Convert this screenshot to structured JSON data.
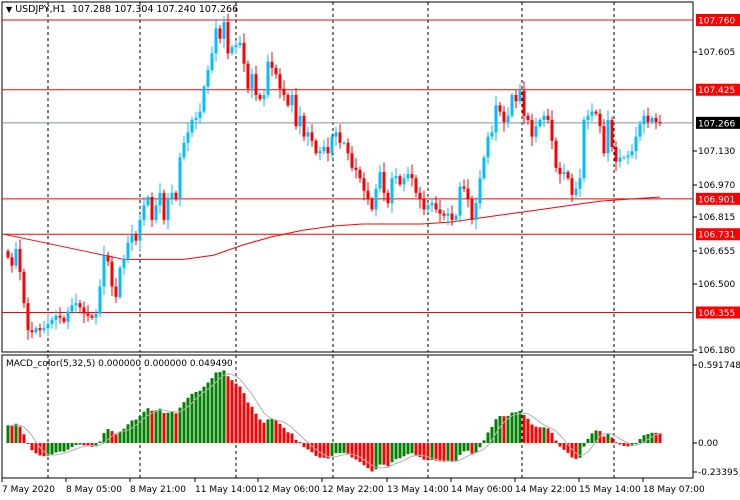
{
  "header": {
    "symbol": "USDJPY,H1",
    "open": "107.288",
    "high": "107.304",
    "low": "107.240",
    "close": "107.266"
  },
  "macd_header": {
    "label": "MACD_color(5,32,5)",
    "v1": "0.000000",
    "v2": "0.000000",
    "v3": "0.049490"
  },
  "colors": {
    "bull": "#00bfff",
    "bear": "#ff0000",
    "macd_up": "#008000",
    "macd_down": "#ff0000",
    "level": "#ff0000",
    "current": "#8090a0",
    "signal": "#b0b0b0"
  },
  "chart_data": [
    {
      "type": "candlestick",
      "title": "USDJPY,H1",
      "ylim": [
        106.18,
        107.76
      ],
      "y_ticks": [
        "107.605",
        "107.130",
        "106.970",
        "106.815",
        "106.655",
        "106.500",
        "106.180"
      ],
      "levels": [
        {
          "value": 107.76,
          "label": "107.760"
        },
        {
          "value": 107.425,
          "label": "107.425"
        },
        {
          "value": 106.901,
          "label": "106.901"
        },
        {
          "value": 106.731,
          "label": "106.731"
        },
        {
          "value": 106.355,
          "label": "106.355"
        }
      ],
      "current_price": {
        "value": 107.266,
        "label": "107.266"
      },
      "x_labels": [
        "7 May 2020",
        "8 May 05:00",
        "8 May 21:00",
        "11 May 14:00",
        "12 May 06:00",
        "12 May 22:00",
        "13 May 14:00",
        "14 May 06:00",
        "14 May 22:00",
        "15 May 14:00",
        "18 May 07:00"
      ],
      "closes": [
        106.62,
        106.58,
        106.66,
        106.55,
        106.4,
        106.27,
        106.26,
        106.28,
        106.27,
        106.28,
        106.3,
        106.32,
        106.34,
        106.33,
        106.31,
        106.36,
        106.39,
        106.4,
        106.38,
        106.35,
        106.34,
        106.33,
        106.35,
        106.48,
        106.63,
        106.6,
        106.48,
        106.43,
        106.57,
        106.61,
        106.69,
        106.73,
        106.7,
        106.8,
        106.87,
        106.91,
        106.8,
        106.87,
        106.93,
        106.8,
        106.9,
        106.93,
        106.9,
        107.1,
        107.17,
        107.22,
        107.28,
        107.29,
        107.32,
        107.44,
        107.52,
        107.6,
        107.72,
        107.67,
        107.75,
        107.6,
        107.63,
        107.64,
        107.65,
        107.55,
        107.43,
        107.5,
        107.4,
        107.38,
        107.4,
        107.56,
        107.53,
        107.5,
        107.43,
        107.4,
        107.35,
        107.4,
        107.25,
        107.3,
        107.2,
        107.22,
        107.18,
        107.12,
        107.13,
        107.15,
        107.12,
        107.2,
        107.22,
        107.17,
        107.17,
        107.12,
        107.05,
        107.04,
        107.0,
        106.94,
        106.9,
        106.85,
        106.95,
        107.03,
        106.93,
        106.88,
        107.0,
        107.01,
        106.97,
        107.0,
        107.02,
        107.0,
        106.93,
        106.9,
        106.85,
        106.87,
        106.88,
        106.85,
        106.83,
        106.82,
        106.83,
        106.8,
        106.82,
        106.96,
        106.95,
        106.9,
        106.8,
        106.88,
        107.0,
        107.1,
        107.2,
        107.22,
        107.35,
        107.32,
        107.27,
        107.3,
        107.4,
        107.37,
        107.42,
        107.3,
        107.28,
        107.2,
        107.25,
        107.28,
        107.3,
        107.28,
        107.18,
        107.05,
        107.02,
        107.03,
        107.0,
        106.92,
        106.95,
        107.0,
        107.28,
        107.3,
        107.32,
        107.31,
        107.25,
        107.12,
        107.28,
        107.15,
        107.08,
        107.1,
        107.1,
        107.11,
        107.13,
        107.2,
        107.26,
        107.3,
        107.27,
        107.29,
        107.27,
        107.266
      ],
      "moving_average": [
        106.73,
        106.7,
        106.67,
        106.64,
        106.61,
        106.61,
        106.61,
        106.63,
        106.68,
        106.72,
        106.75,
        106.77,
        106.78,
        106.78,
        106.78,
        106.79,
        106.81,
        106.83,
        106.85,
        106.87,
        106.89,
        106.9,
        106.91
      ]
    },
    {
      "type": "bar",
      "title": "MACD_color(5,32,5)",
      "ylim": [
        -0.233951,
        0.591748
      ],
      "y_ticks": [
        "0.591748",
        "0.00",
        "-0.233951"
      ],
      "fast": 5,
      "slow": 32,
      "signal": 5
    }
  ]
}
